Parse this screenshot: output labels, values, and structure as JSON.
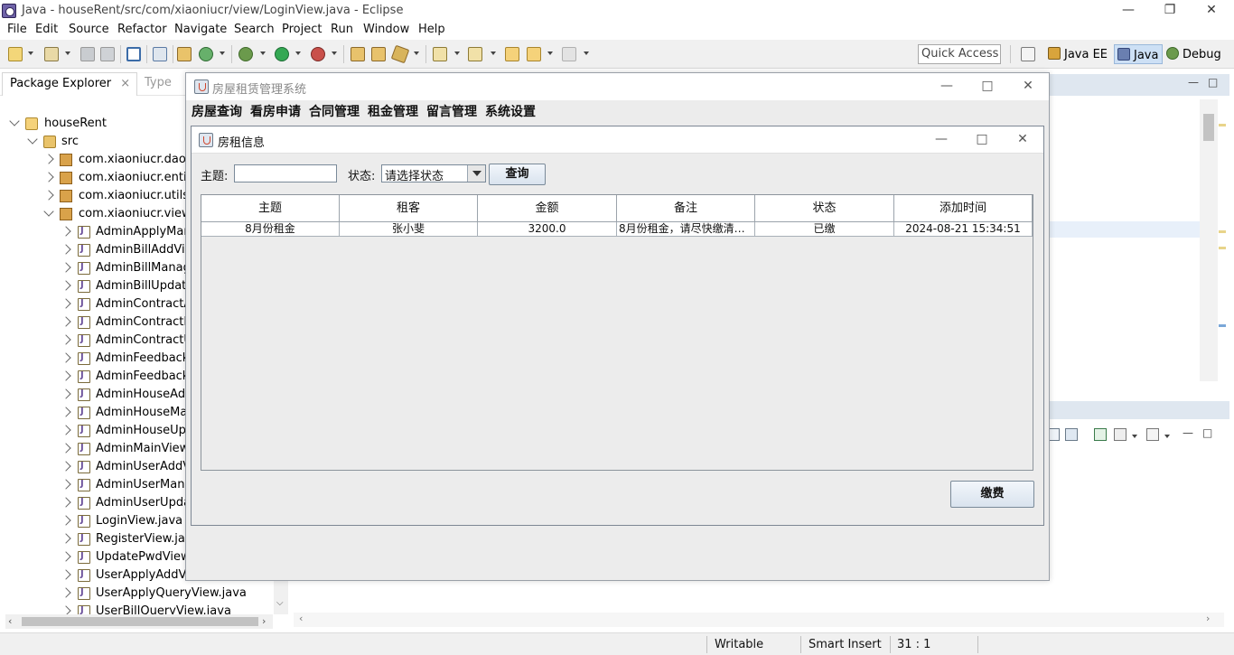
{
  "eclipse": {
    "title": "Java - houseRent/src/com/xiaoniucr/view/LoginView.java - Eclipse",
    "menu": [
      "File",
      "Edit",
      "Source",
      "Refactor",
      "Navigate",
      "Search",
      "Project",
      "Run",
      "Window",
      "Help"
    ],
    "quick_access": "Quick Access",
    "perspectives": [
      "Java EE",
      "Java",
      "Debug"
    ],
    "explorer": {
      "tab_active": "Package Explorer",
      "tab_other": "Type",
      "project": "houseRent",
      "src": "src",
      "packages": [
        "com.xiaoniucr.dao",
        "com.xiaoniucr.entity",
        "com.xiaoniucr.utils",
        "com.xiaoniucr.view"
      ],
      "files": [
        "AdminApplyMana",
        "AdminBillAddView",
        "AdminBillManage",
        "AdminBillUpdateV",
        "AdminContractAd",
        "AdminContractMa",
        "AdminContractUp",
        "AdminFeedbackM",
        "AdminFeedbackR",
        "AdminHouseAddV",
        "AdminHouseMan",
        "AdminHouseUpd",
        "AdminMainView.j",
        "AdminUserAddVi",
        "AdminUserManag",
        "AdminUserUpdat",
        "LoginView.java",
        "RegisterView.java",
        "UpdatePwdView.j",
        "UserApplyAddView.java",
        "UserApplyQueryView.java",
        "UserBillQueryView.java"
      ]
    },
    "status": {
      "writable": "Writable",
      "insert_mode": "Smart Insert",
      "position": "31 : 1"
    }
  },
  "app": {
    "title": "房屋租赁管理系统",
    "menu": [
      "房屋查询",
      "看房申请",
      "合同管理",
      "租金管理",
      "留言管理",
      "系统设置"
    ],
    "inner": {
      "title": "房租信息",
      "subject_label": "主题:",
      "subject_value": "",
      "status_label": "状态:",
      "status_selected": "请选择状态",
      "query_button": "查询",
      "pay_button": "缴费",
      "table": {
        "columns": [
          "主题",
          "租客",
          "金额",
          "备注",
          "状态",
          "添加时间"
        ],
        "rows": [
          [
            "8月份租金",
            "张小斐",
            "3200.0",
            "8月份租金，请尽快缴清，…",
            "已缴",
            "2024-08-21 15:34:51"
          ]
        ]
      }
    }
  }
}
